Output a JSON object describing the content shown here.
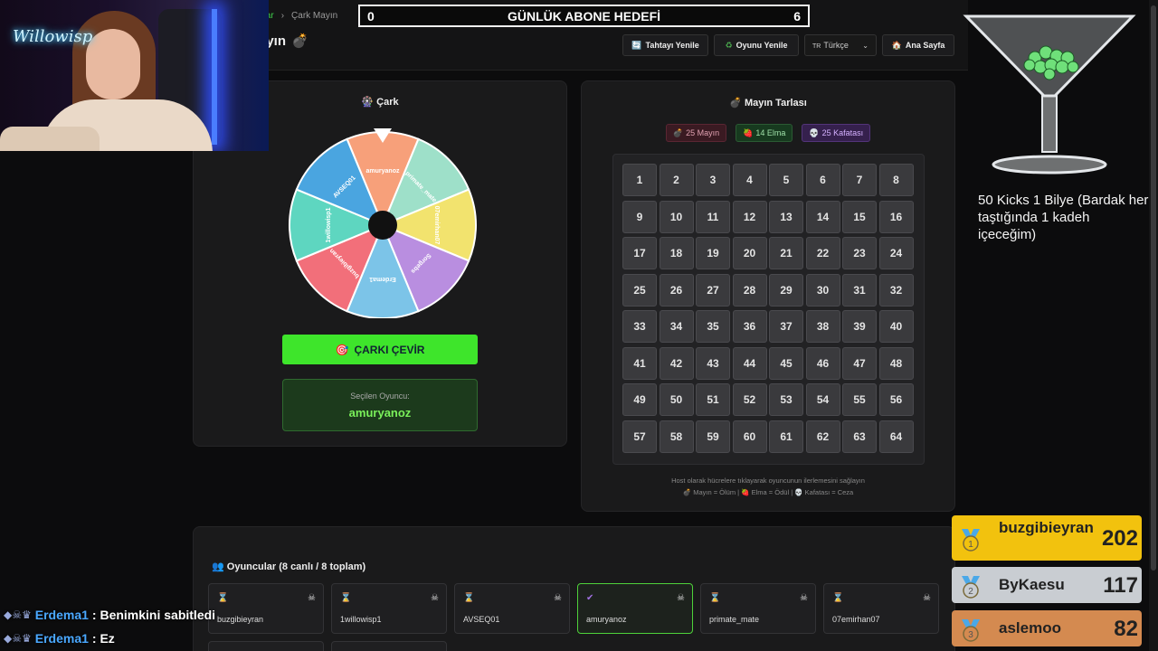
{
  "breadcrumb": {
    "prev": "nlar",
    "current": "Çark Mayın"
  },
  "page_title": "ayın",
  "goal": {
    "left": "0",
    "title": "GÜNLÜK ABONE HEDEFİ",
    "right": "6"
  },
  "toolbar": {
    "refresh_board": "Tahtayı Yenile",
    "refresh_game": "Oyunu Yenile",
    "language": "Türkçe",
    "language_flag": "TR",
    "home": "Ana Sayfa"
  },
  "wheel": {
    "title": "Çark",
    "segments": [
      {
        "label": "amuryanoz",
        "color": "#f7a07a"
      },
      {
        "label": "primate_mate",
        "color": "#9ee0c9"
      },
      {
        "label": "07emirhan07",
        "color": "#f2e36e"
      },
      {
        "label": "Sorgebs",
        "color": "#b98ee0"
      },
      {
        "label": "Erdema1",
        "color": "#7cc4e8"
      },
      {
        "label": "buzgibieyran",
        "color": "#f26f7a"
      },
      {
        "label": "1willowisp1",
        "color": "#5ed6c0"
      },
      {
        "label": "AVSEQ01",
        "color": "#4aa5e0"
      }
    ],
    "spin_label": "ÇARKI ÇEVİR",
    "selected_label": "Seçilen Oyuncu:",
    "selected_value": "amuryanoz"
  },
  "minefield": {
    "title": "Mayın Tarlası",
    "badges": {
      "mines": "25 Mayın",
      "apples": "14 Elma",
      "skulls": "25 Kafatası"
    },
    "cells": [
      1,
      2,
      3,
      4,
      5,
      6,
      7,
      8,
      9,
      10,
      11,
      12,
      13,
      14,
      15,
      16,
      17,
      18,
      19,
      20,
      21,
      22,
      23,
      24,
      25,
      26,
      27,
      28,
      29,
      30,
      31,
      32,
      33,
      34,
      35,
      36,
      37,
      38,
      39,
      40,
      41,
      42,
      43,
      44,
      45,
      46,
      47,
      48,
      49,
      50,
      51,
      52,
      53,
      54,
      55,
      56,
      57,
      58,
      59,
      60,
      61,
      62,
      63,
      64
    ],
    "host_note": "Host olarak hücrelere tıklayarak oyuncunun ilerlemesini sağlayın",
    "legend": "💣 Mayın = Ölüm | 🍓 Elma = Ödül | 💀 Kafatası = Ceza"
  },
  "players": {
    "title": "Oyuncular (8 canlı / 8 toplam)",
    "list": [
      {
        "name": "buzgibieyran",
        "status": "⌛",
        "active": false
      },
      {
        "name": "1willowisp1",
        "status": "⌛",
        "active": false
      },
      {
        "name": "AVSEQ01",
        "status": "⌛",
        "active": false
      },
      {
        "name": "amuryanoz",
        "status": "✔",
        "active": true
      },
      {
        "name": "primate_mate",
        "status": "⌛",
        "active": false
      },
      {
        "name": "07emirhan07",
        "status": "⌛",
        "active": false
      }
    ]
  },
  "overlay": {
    "webcam_sign": "Willowisp",
    "kicks_text": "50 Kicks 1 Bilye (Bardak her taştığında 1 kadeh içeceğim)"
  },
  "leaderboard": [
    {
      "rank": "1",
      "name": "buzgibieyran",
      "score": "202",
      "color": "#f2c20e"
    },
    {
      "rank": "2",
      "name": "ByKaesu",
      "score": "117",
      "color": "#c9cdd2"
    },
    {
      "rank": "3",
      "name": "aslemoo",
      "score": "82",
      "color": "#d48a50"
    }
  ],
  "chat": [
    {
      "user": "Erdema1",
      "message": ": Benimkini sabitledi"
    },
    {
      "user": "Erdema1",
      "message": ": Ez"
    }
  ]
}
